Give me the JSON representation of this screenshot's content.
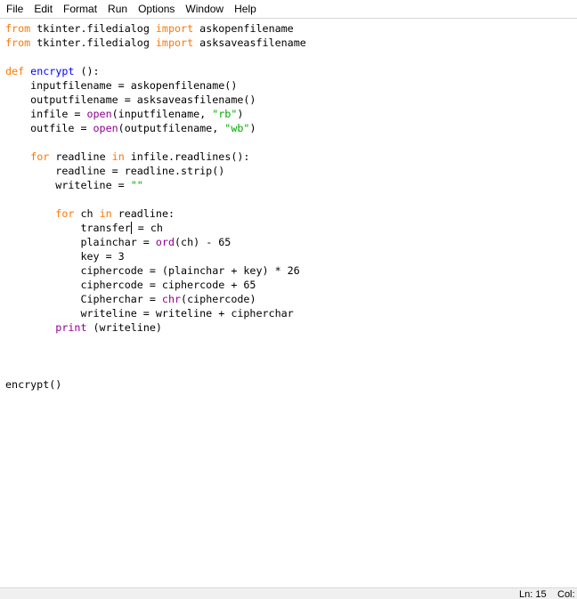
{
  "menu": {
    "items": [
      "File",
      "Edit",
      "Format",
      "Run",
      "Options",
      "Window",
      "Help"
    ]
  },
  "colors": {
    "keyword": "#ff7700",
    "builtin": "#900090",
    "string": "#00aa00",
    "definition": "#0000ff",
    "text": "#000000"
  },
  "editor": {
    "caret_line": 11,
    "lines": [
      [
        {
          "t": "from",
          "c": "keyword"
        },
        {
          "t": " tkinter.filedialog "
        },
        {
          "t": "import",
          "c": "keyword"
        },
        {
          "t": " askopenfilename"
        }
      ],
      [
        {
          "t": "from",
          "c": "keyword"
        },
        {
          "t": " tkinter.filedialog "
        },
        {
          "t": "import",
          "c": "keyword"
        },
        {
          "t": " asksaveasfilename"
        }
      ],
      [],
      [
        {
          "t": "def",
          "c": "keyword"
        },
        {
          "t": " "
        },
        {
          "t": "encrypt",
          "c": "def"
        },
        {
          "t": " ():"
        }
      ],
      [
        {
          "t": "    inputfilename = askopenfilename()"
        }
      ],
      [
        {
          "t": "    outputfilename = asksaveasfilename()"
        }
      ],
      [
        {
          "t": "    infile = "
        },
        {
          "t": "open",
          "c": "builtin"
        },
        {
          "t": "(inputfilename, "
        },
        {
          "t": "\"rb\"",
          "c": "string"
        },
        {
          "t": ")"
        }
      ],
      [
        {
          "t": "    outfile = "
        },
        {
          "t": "open",
          "c": "builtin"
        },
        {
          "t": "(outputfilename, "
        },
        {
          "t": "\"wb\"",
          "c": "string"
        },
        {
          "t": ")"
        }
      ],
      [],
      [
        {
          "t": "    "
        },
        {
          "t": "for",
          "c": "keyword"
        },
        {
          "t": " readline "
        },
        {
          "t": "in",
          "c": "keyword"
        },
        {
          "t": " infile.readlines():"
        }
      ],
      [
        {
          "t": "        readline = readline.strip()"
        }
      ],
      [
        {
          "t": "        writeline = "
        },
        {
          "t": "\"\"",
          "c": "string"
        }
      ],
      [],
      [
        {
          "t": "        "
        },
        {
          "t": "for",
          "c": "keyword"
        },
        {
          "t": " ch "
        },
        {
          "t": "in",
          "c": "keyword"
        },
        {
          "t": " readline:"
        }
      ],
      [
        {
          "t": "            transfer",
          "caret": true
        },
        {
          "t": " = ch"
        }
      ],
      [
        {
          "t": "            plainchar = "
        },
        {
          "t": "ord",
          "c": "builtin"
        },
        {
          "t": "(ch) - 65"
        }
      ],
      [
        {
          "t": "            key = 3"
        }
      ],
      [
        {
          "t": "            ciphercode = (plainchar + key) * 26"
        }
      ],
      [
        {
          "t": "            ciphercode = ciphercode + 65"
        }
      ],
      [
        {
          "t": "            Cipherchar = "
        },
        {
          "t": "chr",
          "c": "builtin"
        },
        {
          "t": "(ciphercode)"
        }
      ],
      [
        {
          "t": "            writeline = writeline + cipherchar"
        }
      ],
      [
        {
          "t": "        "
        },
        {
          "t": "print",
          "c": "builtin"
        },
        {
          "t": " (writeline)"
        }
      ],
      [],
      [],
      [],
      [
        {
          "t": "encrypt()"
        }
      ]
    ]
  },
  "status": {
    "line": "Ln: 15",
    "col": "Col:"
  }
}
